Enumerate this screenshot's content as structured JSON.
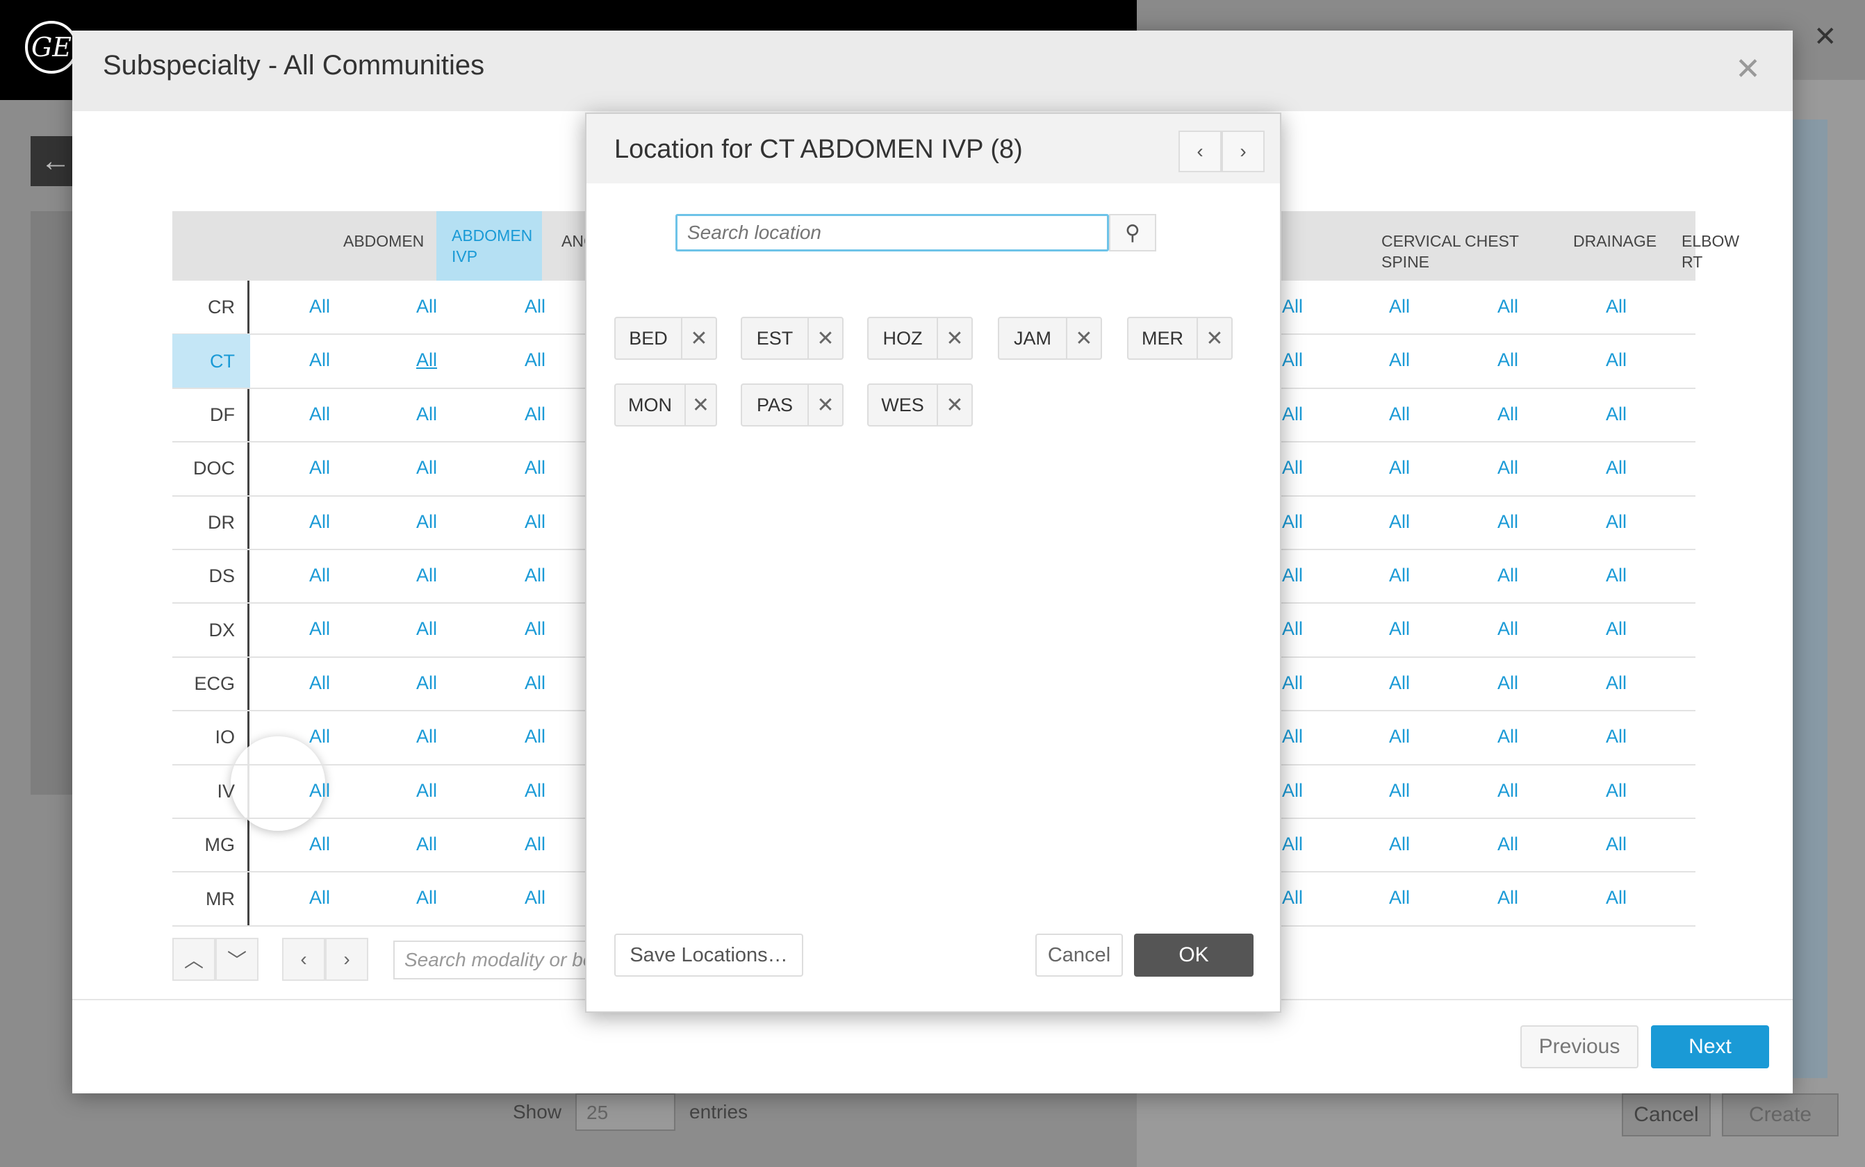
{
  "background": {
    "logo_text": "GE",
    "show_label": "Show",
    "show_value": "25",
    "entries_label": "entries",
    "cancel_label": "Cancel",
    "create_label": "Create",
    "back_icon": "arrow-left-icon"
  },
  "main_modal": {
    "title": "Subspecialty - All Communities",
    "close_icon": "close-icon",
    "previous_label": "Previous",
    "next_label": "Next",
    "grid": {
      "columns_left": [
        "ABDOMEN",
        "ABDOMEN IVP",
        "ANGIOGRAM"
      ],
      "columns_right": [
        "CERVICAL SPINE",
        "CHEST",
        "DRAINAGE",
        "ELBOW RT"
      ],
      "active_column": "ABDOMEN IVP",
      "rows": [
        "CR",
        "CT",
        "DF",
        "DOC",
        "DR",
        "DS",
        "DX",
        "ECG",
        "IO",
        "IV",
        "MG",
        "MR"
      ],
      "active_row": "CT",
      "cell_value": "All",
      "search_placeholder": "Search modality or body part"
    }
  },
  "location_dialog": {
    "title": "Location for CT ABDOMEN IVP (8)",
    "search_placeholder": "Search location",
    "locations": [
      "BED",
      "EST",
      "HOZ",
      "JAM",
      "MER",
      "MON",
      "PAS",
      "WES"
    ],
    "save_label": "Save Locations…",
    "cancel_label": "Cancel",
    "ok_label": "OK"
  },
  "colors": {
    "accent": "#1a9ad6",
    "active_bg": "#b5e0f3",
    "ok_button": "#555555"
  }
}
